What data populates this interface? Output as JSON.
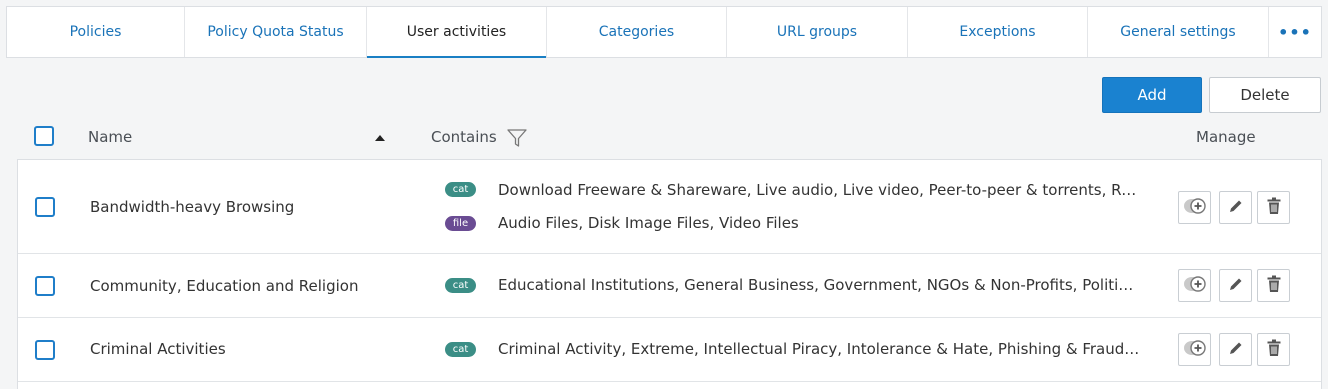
{
  "tabs": [
    {
      "label": "Policies"
    },
    {
      "label": "Policy Quota Status"
    },
    {
      "label": "User activities"
    },
    {
      "label": "Categories"
    },
    {
      "label": "URL groups"
    },
    {
      "label": "Exceptions"
    },
    {
      "label": "General settings"
    },
    {
      "label": "•••"
    }
  ],
  "active_tab": "User activities",
  "actions": {
    "add_label": "Add",
    "delete_label": "Delete"
  },
  "table": {
    "columns": {
      "name": "Name",
      "contains": "Contains",
      "manage": "Manage"
    },
    "sort": "name-ascending",
    "rows": [
      {
        "name": "Bandwidth-heavy Browsing",
        "contains": [
          {
            "badge": "cat",
            "text": "Download Freeware & Shareware, Live audio, Live video, Peer-to-peer & torrents, Radio & TV, Streaming Media, Video"
          },
          {
            "badge": "file",
            "text": "Audio Files, Disk Image Files, Video Files"
          }
        ]
      },
      {
        "name": "Community, Education and Religion",
        "contains": [
          {
            "badge": "cat",
            "text": "Educational Institutions, General Business, Government, NGOs & Non-Profits, Political Organizations, Religion"
          }
        ]
      },
      {
        "name": "Criminal Activities",
        "contains": [
          {
            "badge": "cat",
            "text": "Criminal Activity, Extreme, Intellectual Piracy, Intolerance & Hate, Phishing & Fraud, Plagiarism"
          }
        ]
      }
    ]
  },
  "colors": {
    "accent": "#1a82d0",
    "cat_badge": "#3b8e86",
    "file_badge": "#6a4c93",
    "link": "#1a73b8"
  },
  "icons": {
    "manage_add": "add-circle-icon",
    "manage_edit": "pencil-icon",
    "manage_delete": "trash-icon",
    "filter": "filter-icon",
    "sort": "sort-ascending-icon"
  }
}
